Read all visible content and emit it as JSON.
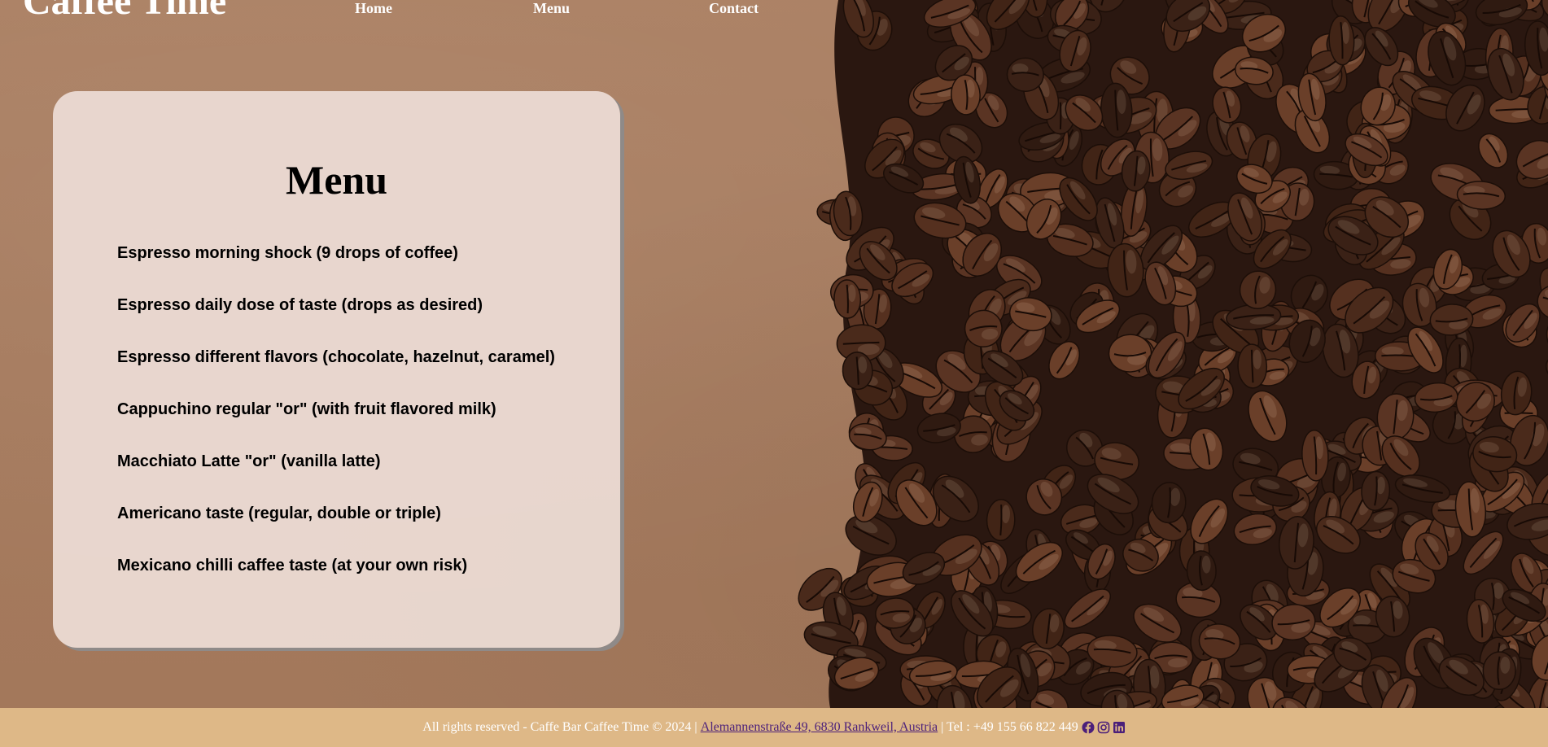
{
  "header": {
    "brand": "Caffee Time",
    "nav": [
      {
        "label": "Home"
      },
      {
        "label": "Menu"
      },
      {
        "label": "Contact"
      }
    ]
  },
  "menu_card": {
    "title": "Menu",
    "items": [
      "Espresso morning shock (9 drops of coffee)",
      "Espresso daily dose of taste (drops as desired)",
      "Espresso different flavors (chocolate, hazelnut, caramel)",
      "Cappuchino regular \"or\" (with fruit flavored milk)",
      "Macchiato Latte \"or\" (vanilla latte)",
      "Americano taste (regular, double or triple)",
      "Mexicano chilli caffee taste (at your own risk)"
    ]
  },
  "footer": {
    "rights": "All rights reserved - Caffe Bar Caffee Time © 2024 |",
    "address_link": "Alemannenstraße 49, 6830 Rankweil, Austria",
    "phone": "| Tel : +49 155 66 822 449",
    "social_icons": [
      "facebook-icon",
      "instagram-icon",
      "linkedin-icon"
    ]
  },
  "colors": {
    "footer_bg": "#deb887",
    "link": "#4b1f7a",
    "card_bg": "#eadad2",
    "background": "#a77b5e"
  }
}
